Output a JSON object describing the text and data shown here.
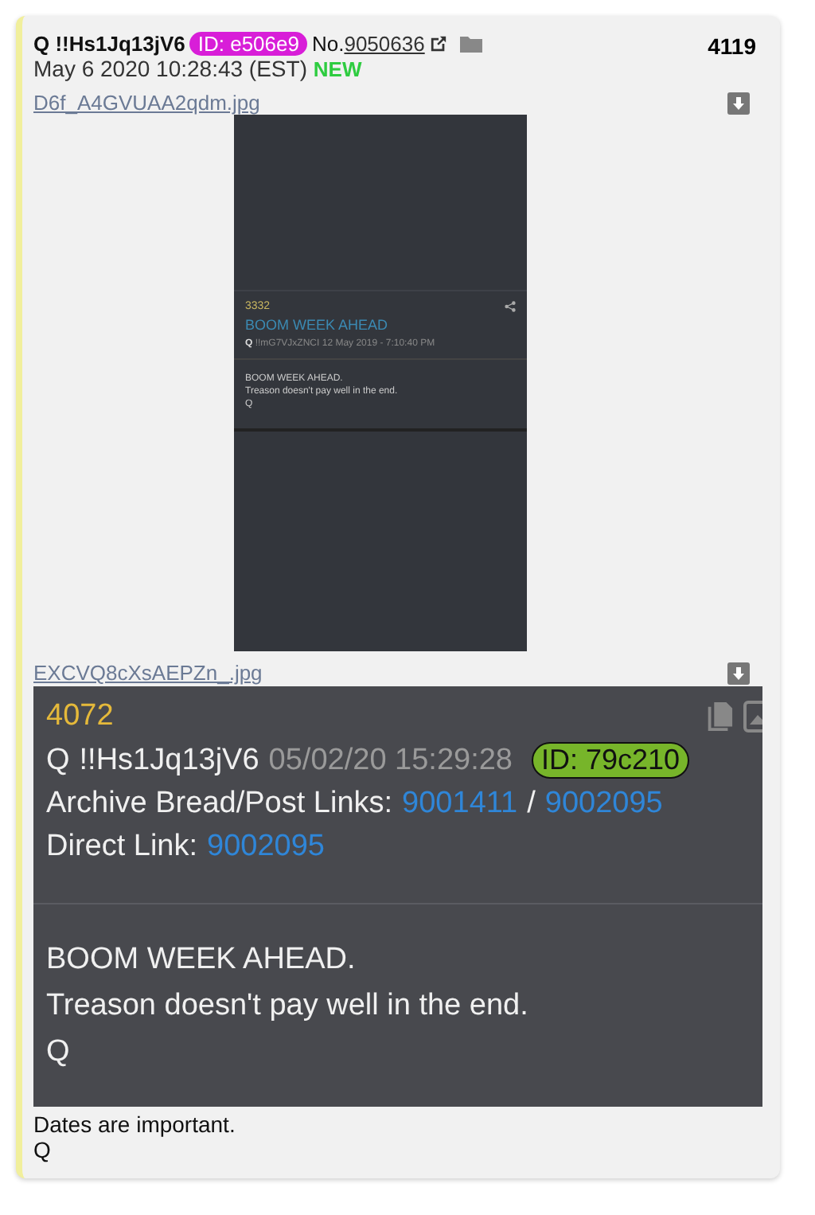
{
  "post": {
    "author": "Q",
    "tripcode": "!!Hs1Jq13jV6",
    "id_badge": "ID: e506e9",
    "no_label": "No.",
    "number": "9050636",
    "date": "May 6 2020 10:28:43 (EST)",
    "new_tag": "NEW",
    "count": "4119",
    "attachments": [
      {
        "filename": "D6f_A4GVUAA2qdm.jpg",
        "kind": "phone-screenshot",
        "shot": {
          "number": "3332",
          "title": "BOOM WEEK AHEAD",
          "author": "Q",
          "tripcode": "!!mG7VJxZNCI",
          "date": "12 May 2019 - 7:10:40 PM",
          "body": [
            "BOOM WEEK AHEAD.",
            "Treason doesn't pay well in the end.",
            "Q"
          ]
        }
      },
      {
        "filename": "EXCVQ8cXsAEPZn_.jpg",
        "kind": "card-screenshot",
        "shot": {
          "number": "4072",
          "author": "Q",
          "tripcode": "!!Hs1Jq13jV6",
          "date": "05/02/20 15:29:28",
          "id_badge": "ID: 79c210",
          "archive_label": "Archive Bread/Post Links:",
          "archive_links": [
            "9001411",
            "9002095"
          ],
          "separator": "/",
          "direct_label": "Direct Link:",
          "direct_link": "9002095",
          "body": [
            "BOOM WEEK AHEAD.",
            "Treason doesn't pay well in the end.",
            "Q"
          ]
        }
      }
    ],
    "message": [
      "Dates are important.",
      "Q"
    ]
  }
}
